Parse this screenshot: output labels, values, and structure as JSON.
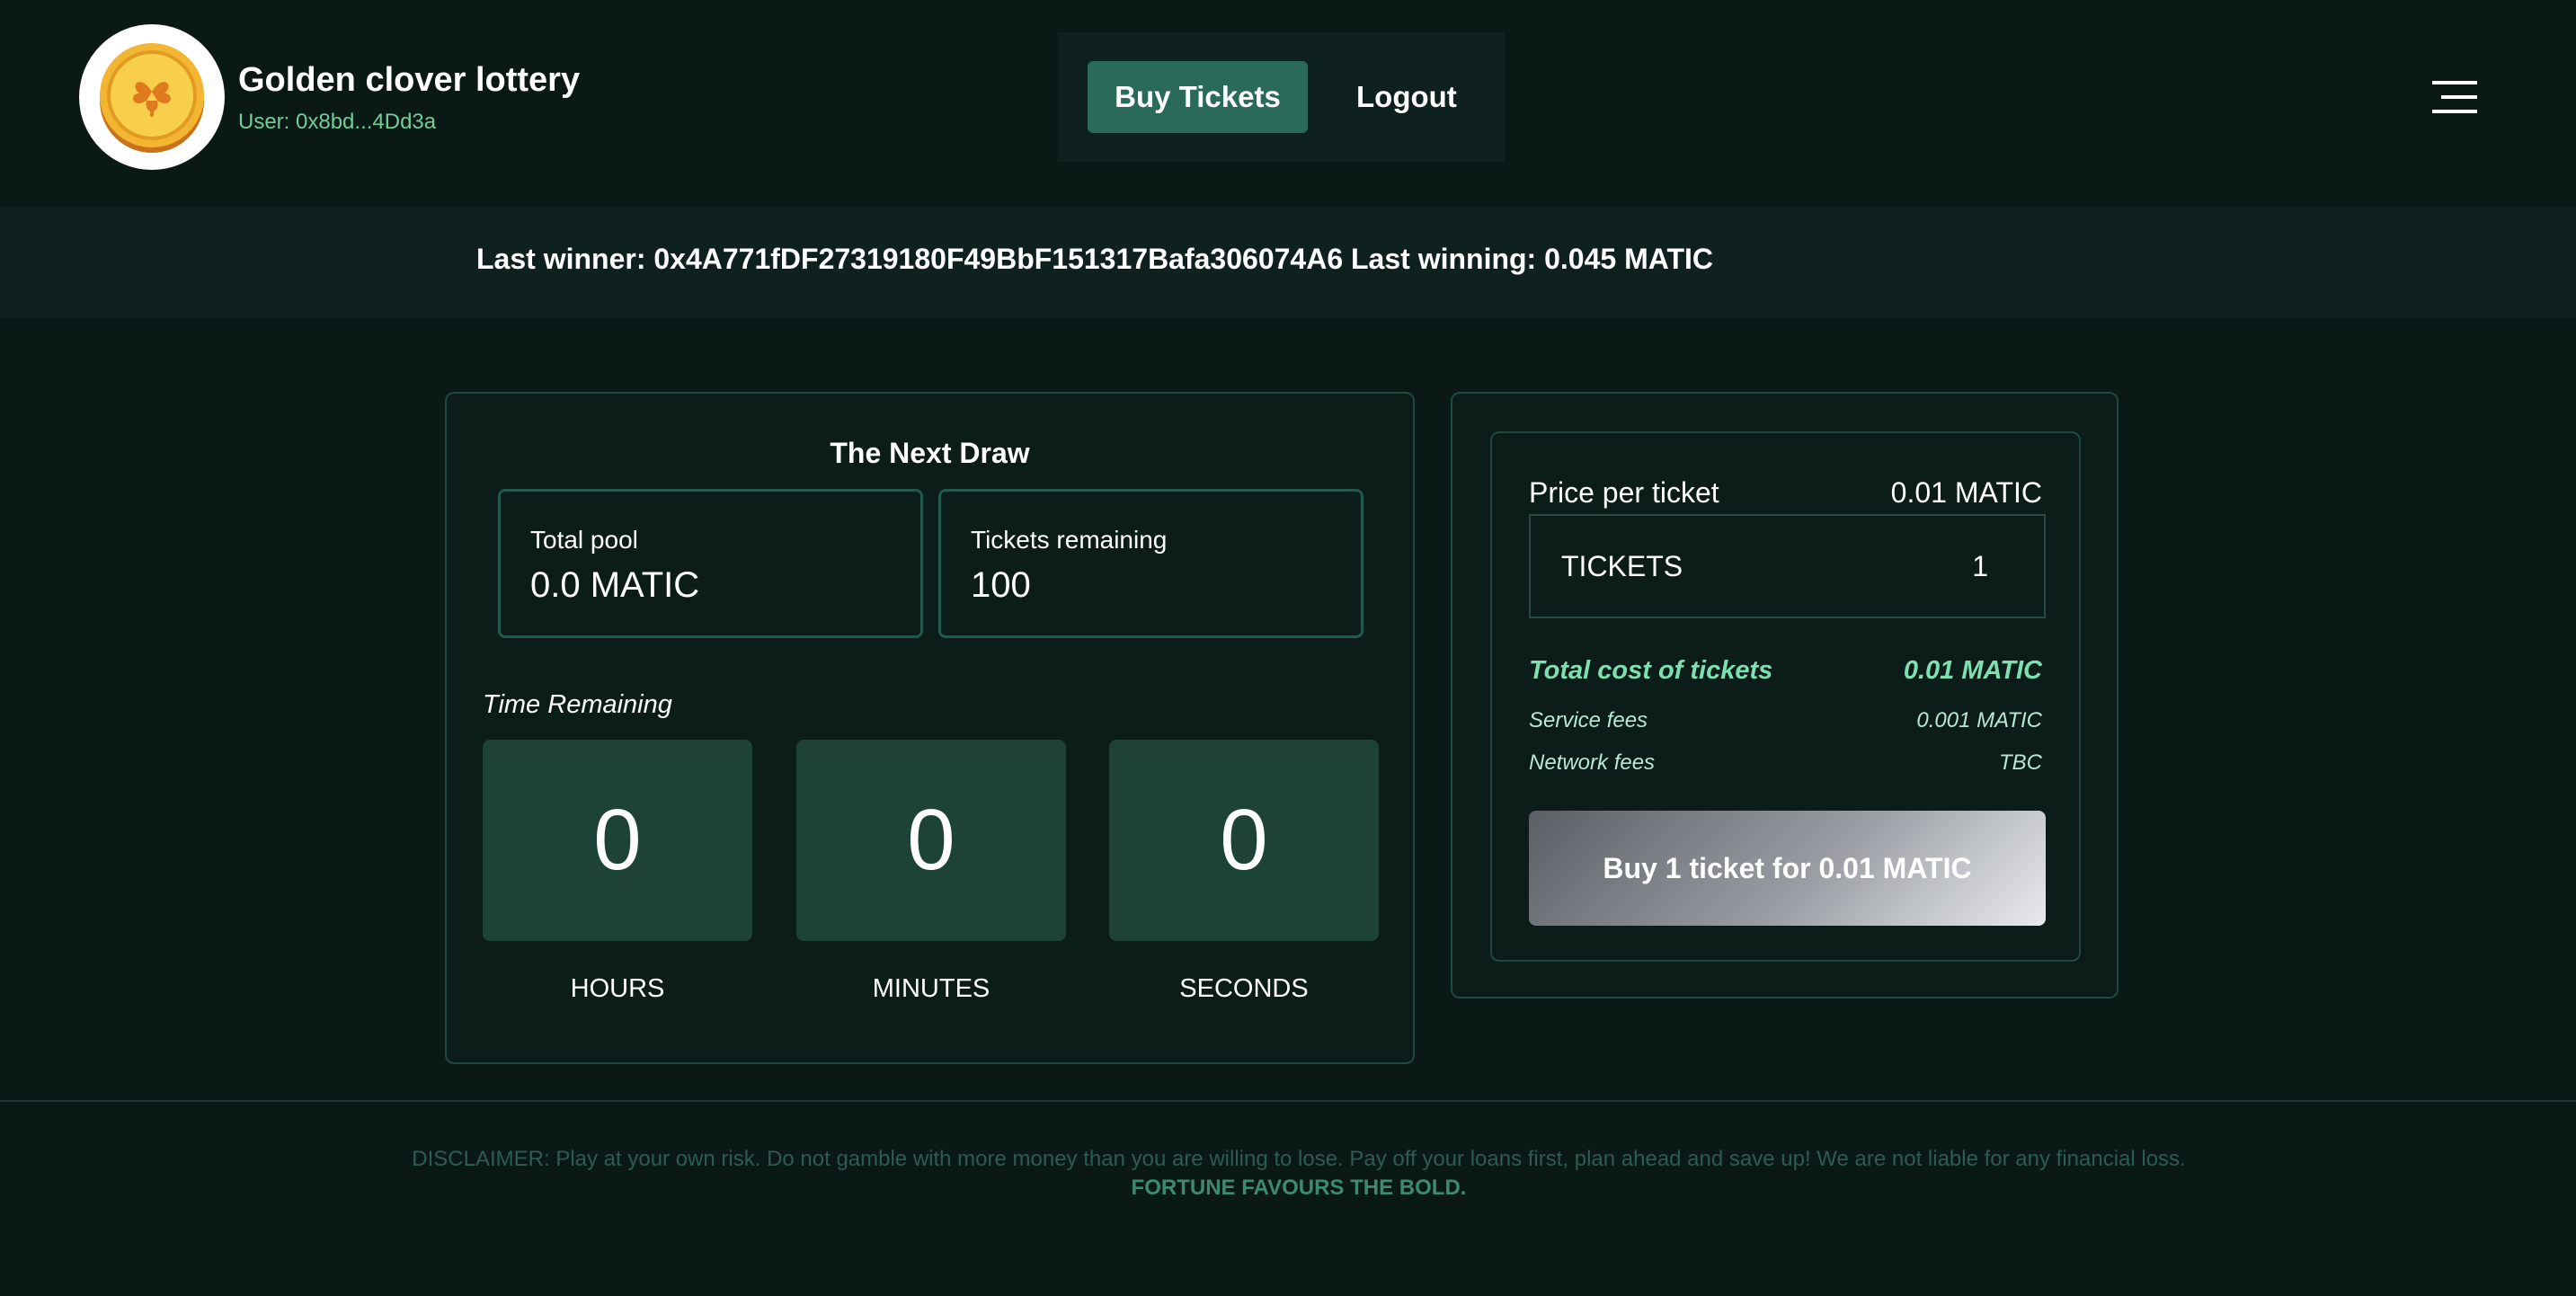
{
  "header": {
    "brand_title": "Golden clover lottery",
    "user_label": "User: 0x8bd...4Dd3a",
    "logo_icon": "golden-clover-coin-icon",
    "menu_icon": "hamburger-menu-icon"
  },
  "nav": {
    "buy_tickets": "Buy Tickets",
    "logout": "Logout"
  },
  "winner_bar": {
    "text": "Last winner: 0x4A771fDF27319180F49BbF151317Bafa306074A6  Last winning: 0.045 MATIC"
  },
  "draw": {
    "title": "The Next Draw",
    "total_pool_label": "Total pool",
    "total_pool_value": "0.0 MATIC",
    "tickets_remaining_label": "Tickets remaining",
    "tickets_remaining_value": "100",
    "time_remaining_label": "Time Remaining",
    "hours_value": "0",
    "minutes_value": "0",
    "seconds_value": "0",
    "hours_label": "HOURS",
    "minutes_label": "MINUTES",
    "seconds_label": "SECONDS"
  },
  "ticket": {
    "price_label": "Price per ticket",
    "price_value": "0.01 MATIC",
    "tickets_field_label": "TICKETS",
    "tickets_field_value": "1",
    "total_cost_label": "Total cost of tickets",
    "total_cost_value": "0.01 MATIC",
    "service_fees_label": "Service fees",
    "service_fees_value": "0.001 MATIC",
    "network_fees_label": "Network fees",
    "network_fees_value": "TBC",
    "buy_button": "Buy 1 ticket for 0.01 MATIC"
  },
  "footer": {
    "disclaimer": "DISCLAIMER: Play at your own risk. Do not gamble with more money than you are willing to lose. Pay off your loans first, plan ahead and save up! We are not liable for any financial loss.",
    "motto": "FORTUNE FAVOURS THE BOLD."
  },
  "colors": {
    "background": "#0a1816",
    "panel": "#0f211e",
    "accent_button": "#2a6a5a",
    "accent_text": "#6fcf97",
    "time_box": "#1d4238"
  }
}
